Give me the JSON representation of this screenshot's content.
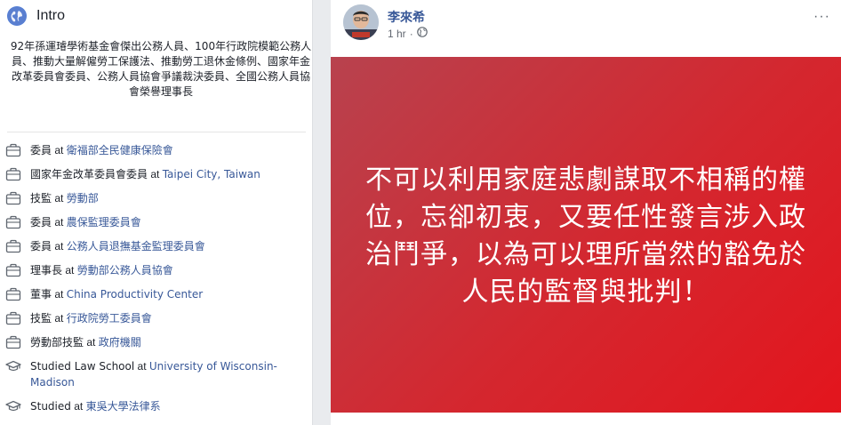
{
  "intro": {
    "title": "Intro",
    "bio": "92年孫運璿學術基金會傑出公務人員、100年行政院模範公務人員、推動大量解僱勞工保護法、推動勞工退休金條例、國家年金改革委員會委員、公務人員協會爭議裁決委員、全國公務人員協會榮譽理事長",
    "items": [
      {
        "icon": "briefcase-icon",
        "role": "委員",
        "at": " at ",
        "org": "衛福部全民健康保險會"
      },
      {
        "icon": "briefcase-icon",
        "role": "國家年金改革委員會委員",
        "at": " at ",
        "org": "Taipei City, Taiwan"
      },
      {
        "icon": "briefcase-icon",
        "role": "技監",
        "at": " at ",
        "org": "勞動部"
      },
      {
        "icon": "briefcase-icon",
        "role": "委員",
        "at": " at ",
        "org": "農保監理委員會"
      },
      {
        "icon": "briefcase-icon",
        "role": "委員",
        "at": " at ",
        "org": "公務人員退撫基金監理委員會"
      },
      {
        "icon": "briefcase-icon",
        "role": "理事長",
        "at": " at ",
        "org": "勞動部公務人員協會"
      },
      {
        "icon": "briefcase-icon",
        "role": "董事",
        "at": " at ",
        "org": "China Productivity Center"
      },
      {
        "icon": "briefcase-icon",
        "role": "技監",
        "at": " at ",
        "org": "行政院勞工委員會"
      },
      {
        "icon": "briefcase-icon",
        "role": "勞動部技監",
        "at": " at ",
        "org": "政府機關"
      },
      {
        "icon": "graduation-cap-icon",
        "role": "Studied Law School",
        "at": " at ",
        "org": "University of Wisconsin-Madison"
      },
      {
        "icon": "graduation-cap-icon",
        "role": "Studied",
        "at": " at ",
        "org": "東吳大學法律系"
      }
    ]
  },
  "post": {
    "author": "李來希",
    "time": "1 hr",
    "separator": "·",
    "audience_icon": "globe-icon",
    "more": "···",
    "banner_text": "不可以利用家庭悲劇謀取不相稱的權位，忘卻初衷，又要任性發言涉入政治鬥爭，以為可以理所當然的豁免於人民的監督與批判！",
    "colors": {
      "link": "#385898",
      "banner_start": "#b8424e",
      "banner_end": "#e3151d"
    }
  }
}
